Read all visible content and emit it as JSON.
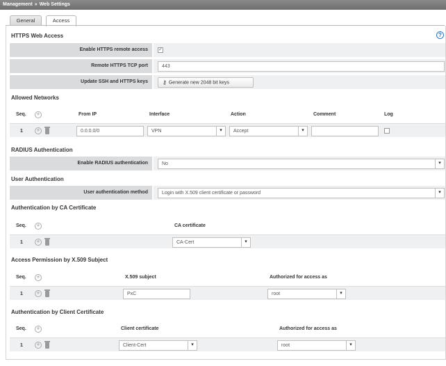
{
  "breadcrumb": {
    "root": "Management",
    "separator": "»",
    "current": "Web Settings"
  },
  "tabs": [
    {
      "label": "General"
    },
    {
      "label": "Access"
    }
  ],
  "https": {
    "title": "HTTPS Web Access",
    "enable_label": "Enable HTTPS remote access",
    "enable_checked": true,
    "port_label": "Remote HTTPS TCP port",
    "port_value": "443",
    "update_label": "Update SSH and HTTPS keys",
    "generate_button": "Generate new 2048 bit keys"
  },
  "allowed": {
    "title": "Allowed Networks",
    "headers": {
      "seq": "Seq.",
      "from_ip": "From IP",
      "interface": "Interface",
      "action": "Action",
      "comment": "Comment",
      "log": "Log"
    },
    "row": {
      "seq": "1",
      "from_ip": "0.0.0.0/0",
      "interface": "VPN",
      "action": "Accept",
      "comment": "",
      "log": false
    }
  },
  "radius": {
    "title": "RADIUS Authentication",
    "enable_label": "Enable RADIUS authentication",
    "value": "No"
  },
  "userauth": {
    "title": "User Authentication",
    "method_label": "User authentication method",
    "method_value": "Login with X.509 client certificate or password"
  },
  "ca": {
    "title": "Authentication by CA Certificate",
    "headers": {
      "seq": "Seq.",
      "cert": "CA certificate"
    },
    "row": {
      "seq": "1",
      "cert": "CA-Cert"
    }
  },
  "x509": {
    "title": "Access Permission by X.509 Subject",
    "headers": {
      "seq": "Seq.",
      "subject": "X.509 subject",
      "authorized": "Authorized for access as"
    },
    "row": {
      "seq": "1",
      "subject": "PxC",
      "authorized": "root"
    }
  },
  "client": {
    "title": "Authentication by Client Certificate",
    "headers": {
      "seq": "Seq.",
      "cert": "Client certificate",
      "authorized": "Authorized for access as"
    },
    "row": {
      "seq": "1",
      "cert": "Client-Cert",
      "authorized": "root"
    }
  },
  "icons": {
    "help": "?",
    "dropdown": "▾",
    "check": "✓",
    "plus": "+",
    "key": "key-icon"
  },
  "colors": {
    "help_blue": "#2b74c7",
    "label_bg": "#d9dbdc",
    "value_bg": "#eef0f1"
  }
}
